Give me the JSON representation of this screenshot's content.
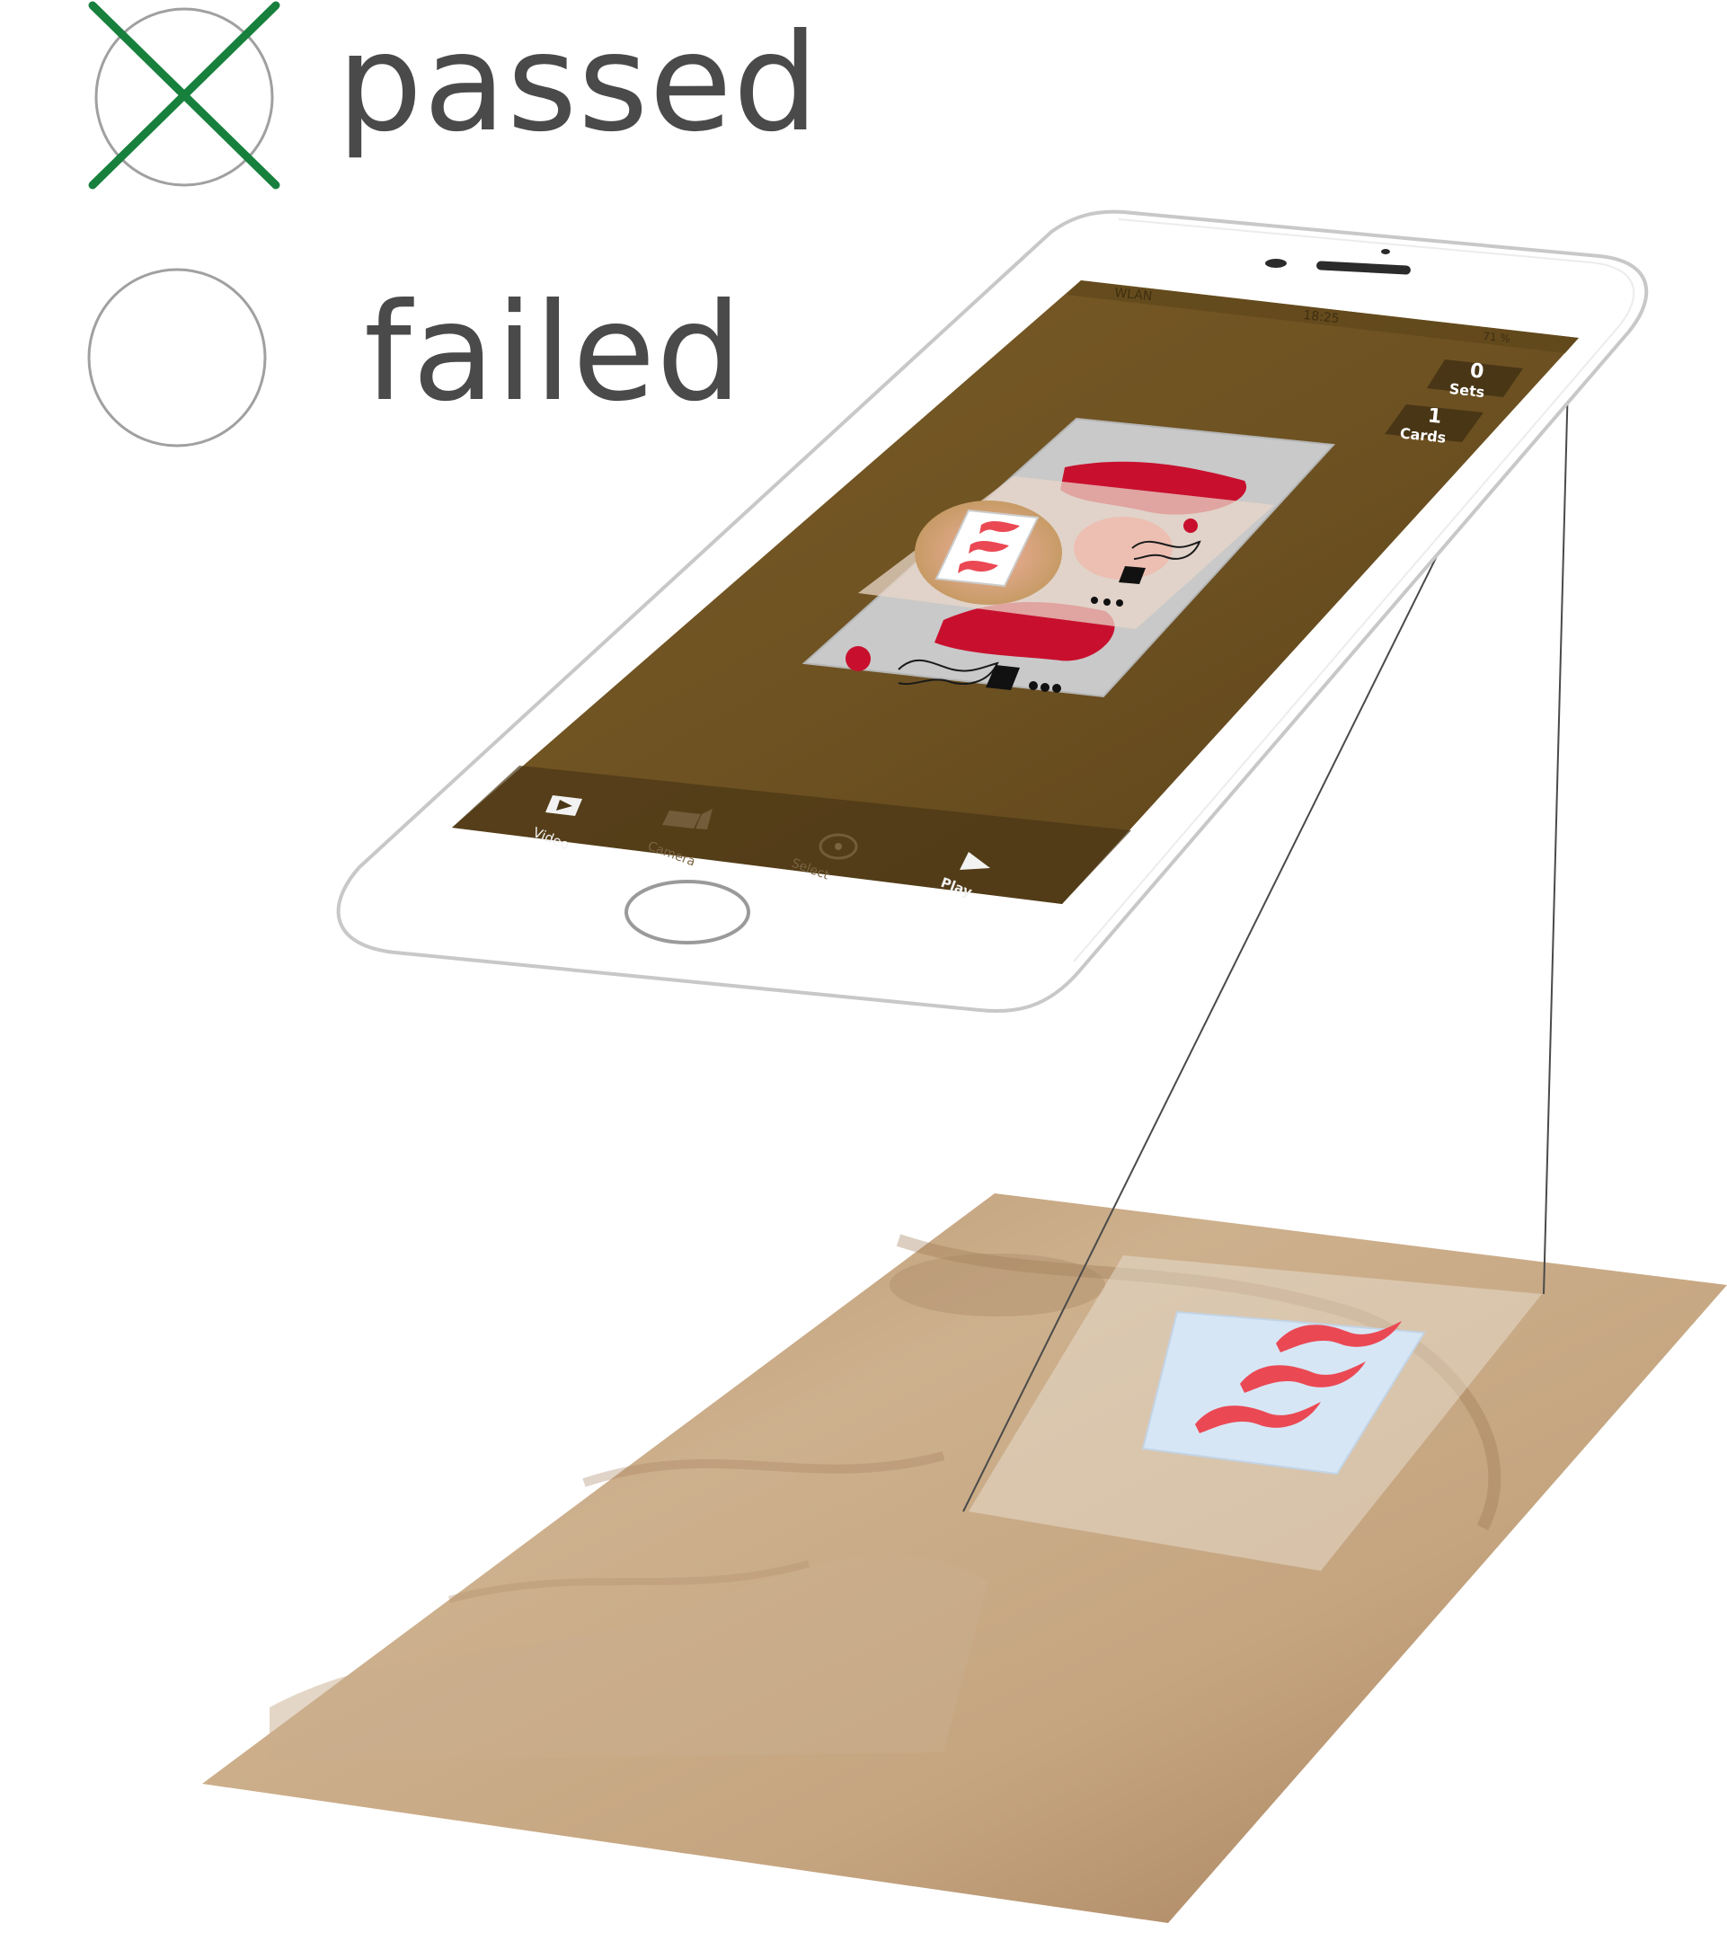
{
  "legend": {
    "passed_label": "passed",
    "failed_label": "failed",
    "passed_icon": "crossed-circle-icon",
    "failed_icon": "empty-circle-icon"
  },
  "phone": {
    "status_bar": {
      "carrier": "WLAN",
      "time": "18:25",
      "battery": "71 %"
    },
    "counters": {
      "sets_value": "0",
      "sets_label": "Sets",
      "cards_value": "1",
      "cards_label": "Cards"
    },
    "tabs": [
      {
        "label": "Video",
        "icon": "play-box-icon",
        "active": true
      },
      {
        "label": "Camera",
        "icon": "video-camera-icon",
        "active": false
      },
      {
        "label": "Select",
        "icon": "target-circle-icon",
        "active": false
      },
      {
        "label": "Play",
        "icon": "play-triangle-icon",
        "active": true
      }
    ]
  },
  "colors": {
    "legend_cross": "#17803d",
    "legend_circle": "#a0a0a0",
    "label_text": "#4a4a4a",
    "card_red": "#c8102e",
    "symbol_red": "#ea4954",
    "wood_screen": "#6e5222",
    "table_wood": "#c7a785",
    "card_bg": "#d7e6f5"
  }
}
